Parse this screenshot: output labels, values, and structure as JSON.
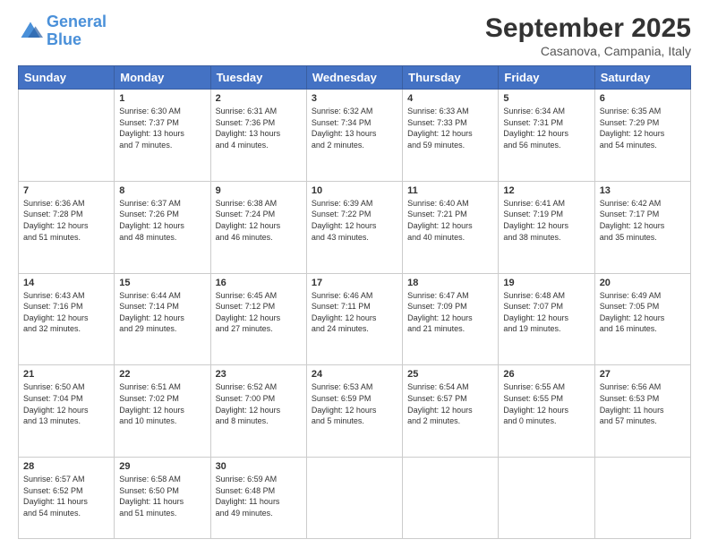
{
  "header": {
    "logo_general": "General",
    "logo_blue": "Blue",
    "month_title": "September 2025",
    "location": "Casanova, Campania, Italy"
  },
  "days_of_week": [
    "Sunday",
    "Monday",
    "Tuesday",
    "Wednesday",
    "Thursday",
    "Friday",
    "Saturday"
  ],
  "weeks": [
    [
      {
        "day": "",
        "info": ""
      },
      {
        "day": "1",
        "info": "Sunrise: 6:30 AM\nSunset: 7:37 PM\nDaylight: 13 hours\nand 7 minutes."
      },
      {
        "day": "2",
        "info": "Sunrise: 6:31 AM\nSunset: 7:36 PM\nDaylight: 13 hours\nand 4 minutes."
      },
      {
        "day": "3",
        "info": "Sunrise: 6:32 AM\nSunset: 7:34 PM\nDaylight: 13 hours\nand 2 minutes."
      },
      {
        "day": "4",
        "info": "Sunrise: 6:33 AM\nSunset: 7:33 PM\nDaylight: 12 hours\nand 59 minutes."
      },
      {
        "day": "5",
        "info": "Sunrise: 6:34 AM\nSunset: 7:31 PM\nDaylight: 12 hours\nand 56 minutes."
      },
      {
        "day": "6",
        "info": "Sunrise: 6:35 AM\nSunset: 7:29 PM\nDaylight: 12 hours\nand 54 minutes."
      }
    ],
    [
      {
        "day": "7",
        "info": "Sunrise: 6:36 AM\nSunset: 7:28 PM\nDaylight: 12 hours\nand 51 minutes."
      },
      {
        "day": "8",
        "info": "Sunrise: 6:37 AM\nSunset: 7:26 PM\nDaylight: 12 hours\nand 48 minutes."
      },
      {
        "day": "9",
        "info": "Sunrise: 6:38 AM\nSunset: 7:24 PM\nDaylight: 12 hours\nand 46 minutes."
      },
      {
        "day": "10",
        "info": "Sunrise: 6:39 AM\nSunset: 7:22 PM\nDaylight: 12 hours\nand 43 minutes."
      },
      {
        "day": "11",
        "info": "Sunrise: 6:40 AM\nSunset: 7:21 PM\nDaylight: 12 hours\nand 40 minutes."
      },
      {
        "day": "12",
        "info": "Sunrise: 6:41 AM\nSunset: 7:19 PM\nDaylight: 12 hours\nand 38 minutes."
      },
      {
        "day": "13",
        "info": "Sunrise: 6:42 AM\nSunset: 7:17 PM\nDaylight: 12 hours\nand 35 minutes."
      }
    ],
    [
      {
        "day": "14",
        "info": "Sunrise: 6:43 AM\nSunset: 7:16 PM\nDaylight: 12 hours\nand 32 minutes."
      },
      {
        "day": "15",
        "info": "Sunrise: 6:44 AM\nSunset: 7:14 PM\nDaylight: 12 hours\nand 29 minutes."
      },
      {
        "day": "16",
        "info": "Sunrise: 6:45 AM\nSunset: 7:12 PM\nDaylight: 12 hours\nand 27 minutes."
      },
      {
        "day": "17",
        "info": "Sunrise: 6:46 AM\nSunset: 7:11 PM\nDaylight: 12 hours\nand 24 minutes."
      },
      {
        "day": "18",
        "info": "Sunrise: 6:47 AM\nSunset: 7:09 PM\nDaylight: 12 hours\nand 21 minutes."
      },
      {
        "day": "19",
        "info": "Sunrise: 6:48 AM\nSunset: 7:07 PM\nDaylight: 12 hours\nand 19 minutes."
      },
      {
        "day": "20",
        "info": "Sunrise: 6:49 AM\nSunset: 7:05 PM\nDaylight: 12 hours\nand 16 minutes."
      }
    ],
    [
      {
        "day": "21",
        "info": "Sunrise: 6:50 AM\nSunset: 7:04 PM\nDaylight: 12 hours\nand 13 minutes."
      },
      {
        "day": "22",
        "info": "Sunrise: 6:51 AM\nSunset: 7:02 PM\nDaylight: 12 hours\nand 10 minutes."
      },
      {
        "day": "23",
        "info": "Sunrise: 6:52 AM\nSunset: 7:00 PM\nDaylight: 12 hours\nand 8 minutes."
      },
      {
        "day": "24",
        "info": "Sunrise: 6:53 AM\nSunset: 6:59 PM\nDaylight: 12 hours\nand 5 minutes."
      },
      {
        "day": "25",
        "info": "Sunrise: 6:54 AM\nSunset: 6:57 PM\nDaylight: 12 hours\nand 2 minutes."
      },
      {
        "day": "26",
        "info": "Sunrise: 6:55 AM\nSunset: 6:55 PM\nDaylight: 12 hours\nand 0 minutes."
      },
      {
        "day": "27",
        "info": "Sunrise: 6:56 AM\nSunset: 6:53 PM\nDaylight: 11 hours\nand 57 minutes."
      }
    ],
    [
      {
        "day": "28",
        "info": "Sunrise: 6:57 AM\nSunset: 6:52 PM\nDaylight: 11 hours\nand 54 minutes."
      },
      {
        "day": "29",
        "info": "Sunrise: 6:58 AM\nSunset: 6:50 PM\nDaylight: 11 hours\nand 51 minutes."
      },
      {
        "day": "30",
        "info": "Sunrise: 6:59 AM\nSunset: 6:48 PM\nDaylight: 11 hours\nand 49 minutes."
      },
      {
        "day": "",
        "info": ""
      },
      {
        "day": "",
        "info": ""
      },
      {
        "day": "",
        "info": ""
      },
      {
        "day": "",
        "info": ""
      }
    ]
  ]
}
